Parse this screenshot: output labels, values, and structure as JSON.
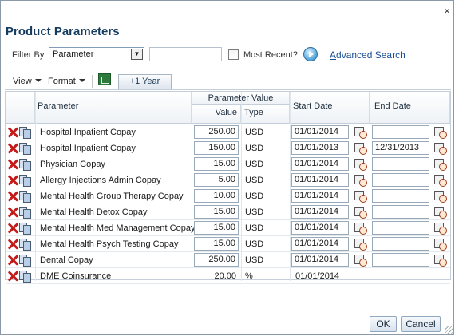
{
  "dialog": {
    "close_glyph": "×",
    "title": "Product Parameters"
  },
  "filter": {
    "label": "Filter By",
    "select_value": "Parameter",
    "text_value": "",
    "most_recent_label": "Most Recent?",
    "most_recent_checked": false,
    "advanced_search_prefix": "A",
    "advanced_search_rest": "dvanced Search"
  },
  "toolbar": {
    "view_label": "View",
    "format_label": "Format",
    "export_icon": "excel-export-icon",
    "plus_year_label": "+1 Year"
  },
  "table": {
    "headers": {
      "parameter": "Parameter",
      "parameter_value": "Parameter Value",
      "value": "Value",
      "type": "Type",
      "start_date": "Start Date",
      "end_date": "End Date"
    },
    "rows": [
      {
        "parameter": "Hospital Inpatient Copay",
        "value": "250.00",
        "type": "USD",
        "start": "01/01/2014",
        "end": "",
        "editable": true
      },
      {
        "parameter": "Hospital Inpatient Copay",
        "value": "150.00",
        "type": "USD",
        "start": "01/01/2013",
        "end": "12/31/2013",
        "editable": true
      },
      {
        "parameter": "Physician Copay",
        "value": "15.00",
        "type": "USD",
        "start": "01/01/2014",
        "end": "",
        "editable": true
      },
      {
        "parameter": "Allergy Injections Admin Copay",
        "value": "5.00",
        "type": "USD",
        "start": "01/01/2014",
        "end": "",
        "editable": true
      },
      {
        "parameter": "Mental Health Group Therapy Copay",
        "value": "10.00",
        "type": "USD",
        "start": "01/01/2014",
        "end": "",
        "editable": true
      },
      {
        "parameter": "Mental Health Detox Copay",
        "value": "15.00",
        "type": "USD",
        "start": "01/01/2014",
        "end": "",
        "editable": true
      },
      {
        "parameter": "Mental Health Med Management Copay",
        "value": "15.00",
        "type": "USD",
        "start": "01/01/2014",
        "end": "",
        "editable": true
      },
      {
        "parameter": "Mental Health Psych Testing Copay",
        "value": "15.00",
        "type": "USD",
        "start": "01/01/2014",
        "end": "",
        "editable": true
      },
      {
        "parameter": "Dental Copay",
        "value": "250.00",
        "type": "USD",
        "start": "01/01/2014",
        "end": "",
        "editable": true
      },
      {
        "parameter": "DME Coinsurance",
        "value": "20.00",
        "type": "%",
        "start": "01/01/2014",
        "end": "",
        "editable": false
      }
    ]
  },
  "footer": {
    "ok_label": "OK",
    "cancel_label": "Cancel"
  },
  "colors": {
    "title": "#153b5e",
    "link": "#1b4f94",
    "delete_icon": "#c41a1a",
    "border": "#c4cfd9"
  }
}
